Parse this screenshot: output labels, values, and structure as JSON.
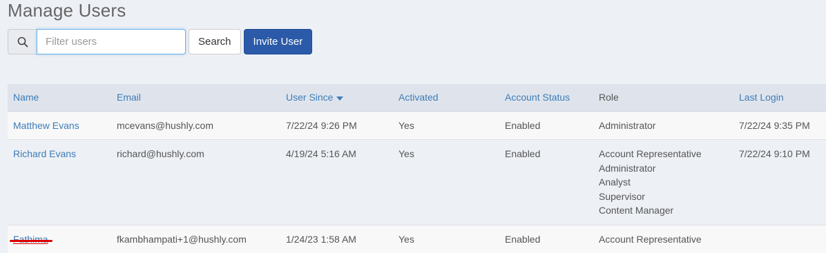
{
  "page": {
    "title": "Manage Users"
  },
  "toolbar": {
    "search_icon": "search-icon",
    "filter_placeholder": "Filter users",
    "filter_value": "",
    "search_label": "Search",
    "invite_label": "Invite User"
  },
  "table": {
    "columns": {
      "name": "Name",
      "email": "Email",
      "user_since": "User Since",
      "activated": "Activated",
      "account_status": "Account Status",
      "role": "Role",
      "last_login": "Last Login"
    },
    "rows": [
      {
        "name": "Matthew Evans",
        "email": "mcevans@hushly.com",
        "user_since": "7/22/24 9:26 PM",
        "activated": "Yes",
        "account_status": "Enabled",
        "roles": [
          "Administrator"
        ],
        "last_login": "7/22/24 9:35 PM"
      },
      {
        "name": "Richard Evans",
        "email": "richard@hushly.com",
        "user_since": "4/19/24 5:16 AM",
        "activated": "Yes",
        "account_status": "Enabled",
        "roles": [
          "Account Representative",
          "Administrator",
          "Analyst",
          "Supervisor",
          "Content Manager"
        ],
        "last_login": "7/22/24 9:10 PM"
      },
      {
        "name": "Fathima",
        "email": "fkambhampati+1@hushly.com",
        "user_since": "1/24/23 1:58 AM",
        "activated": "Yes",
        "account_status": "Enabled",
        "roles": [
          "Account Representative"
        ],
        "last_login": ""
      }
    ]
  },
  "colors": {
    "accent": "#3d7cb8",
    "primary_button": "#2b5aa8",
    "annotation_mark": "#e00000"
  }
}
